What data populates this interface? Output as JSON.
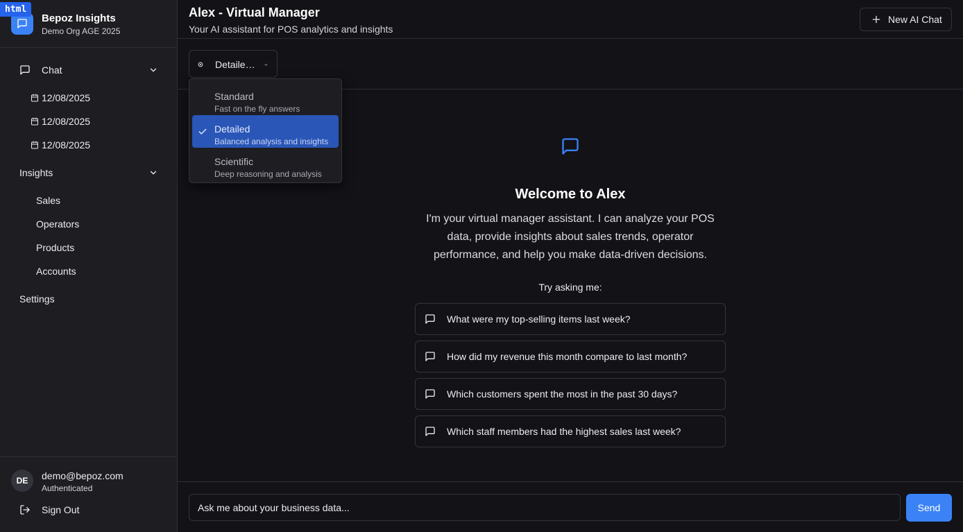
{
  "brand": {
    "badge": "html",
    "name": "Bepoz Insights",
    "org": "Demo Org AGE 2025"
  },
  "sidebar": {
    "chat_label": "Chat",
    "chat_items": [
      "12/08/2025",
      "12/08/2025",
      "12/08/2025"
    ],
    "insights_label": "Insights",
    "insights_items": [
      "Sales",
      "Operators",
      "Products",
      "Accounts"
    ],
    "settings_label": "Settings"
  },
  "user": {
    "initials": "DE",
    "email": "demo@bepoz.com",
    "status": "Authenticated",
    "signout_label": "Sign Out"
  },
  "header": {
    "title": "Alex - Virtual Manager",
    "subtitle": "Your AI assistant for POS analytics and insights",
    "new_chat_label": "New AI Chat"
  },
  "mode": {
    "selected_display": "Detaile…",
    "options": [
      {
        "title": "Standard",
        "desc": "Fast on the fly answers",
        "selected": false
      },
      {
        "title": "Detailed",
        "desc": "Balanced analysis and insights",
        "selected": true
      },
      {
        "title": "Scientific",
        "desc": "Deep reasoning and analysis",
        "selected": false
      }
    ]
  },
  "welcome": {
    "title": "Welcome to Alex",
    "text": "I'm your virtual manager assistant. I can analyze your POS data, provide insights about sales trends, operator performance, and help you make data-driven decisions.",
    "try_label": "Try asking me:",
    "suggestions": [
      "What were my top-selling items last week?",
      "How did my revenue this month compare to last month?",
      "Which customers spent the most in the past 30 days?",
      "Which staff members had the highest sales last week?"
    ]
  },
  "composer": {
    "placeholder": "Ask me about your business data...",
    "send_label": "Send"
  },
  "colors": {
    "accent": "#3b82f6",
    "selected_option": "#2a56b8",
    "background": "#121217",
    "sidebar": "#1d1d22"
  }
}
